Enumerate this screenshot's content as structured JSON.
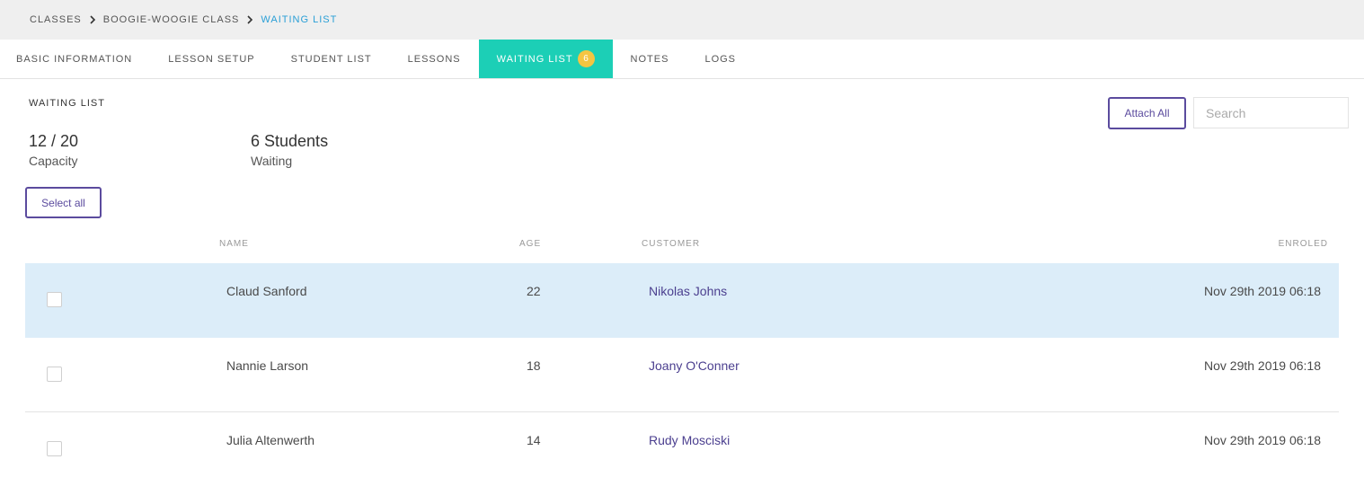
{
  "breadcrumb": [
    {
      "label": "CLASSES"
    },
    {
      "label": "BOOGIE-WOOGIE CLASS"
    },
    {
      "label": "WAITING LIST"
    }
  ],
  "tabs": [
    {
      "label": "BASIC INFORMATION"
    },
    {
      "label": "LESSON SETUP"
    },
    {
      "label": "STUDENT LIST"
    },
    {
      "label": "LESSONS"
    },
    {
      "label": "WAITING LIST",
      "badge": "6",
      "active": true
    },
    {
      "label": "NOTES"
    },
    {
      "label": "LOGS"
    }
  ],
  "section": {
    "title": "WAITING LIST",
    "capacity_value": "12 / 20",
    "capacity_label": "Capacity",
    "waiting_value": "6 Students",
    "waiting_label": "Waiting"
  },
  "actions": {
    "attach_all": "Attach All",
    "search_placeholder": "Search",
    "select_all": "Select all"
  },
  "table": {
    "columns": {
      "name": "NAME",
      "age": "AGE",
      "customer": "CUSTOMER",
      "enroled": "ENROLED"
    },
    "rows": [
      {
        "name": "Claud Sanford",
        "age": "22",
        "customer": "Nikolas Johns",
        "enroled": "Nov 29th 2019 06:18",
        "selected": true
      },
      {
        "name": "Nannie Larson",
        "age": "18",
        "customer": "Joany O'Conner",
        "enroled": "Nov 29th 2019 06:18",
        "selected": false
      },
      {
        "name": "Julia Altenwerth",
        "age": "14",
        "customer": "Rudy Mosciski",
        "enroled": "Nov 29th 2019 06:18",
        "selected": false
      }
    ]
  },
  "colors": {
    "accent_tab": "#1ccfb6",
    "badge": "#f5c542",
    "button_border": "#5b4b9e",
    "selected_row": "#dcedf9",
    "breadcrumb_active": "#2a9fd6"
  }
}
